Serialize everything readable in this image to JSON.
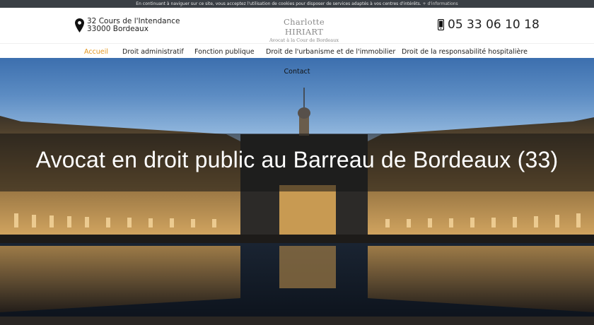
{
  "cookie_bar": {
    "text": "En continuant à naviguer sur ce site, vous acceptez l'utilisation de cookies pour disposer de services adaptés à vos centres d'intérêts.",
    "more_link": "+ d'informations"
  },
  "header": {
    "address_line1": "32 Cours de l'Intendance",
    "address_line2": "33000 Bordeaux",
    "logo_name": "Charlotte HIRIART",
    "logo_tagline": "Avocat à la Cour de Bordeaux",
    "phone": "05 33 06 10 18"
  },
  "nav": {
    "items": [
      {
        "label": "Accueil",
        "active": true
      },
      {
        "label": "Droit administratif"
      },
      {
        "label": "Fonction publique"
      },
      {
        "label": "Droit de l'urbanisme et de l'immobilier"
      },
      {
        "label": "Droit de la responsabilité hospitalière"
      },
      {
        "label": "Contact"
      }
    ]
  },
  "hero": {
    "title": "Avocat en droit public au Barreau de Bordeaux (33)"
  },
  "colors": {
    "accent": "#e3961f",
    "cookie_bar_bg": "#3a3f45",
    "title_band": "#141414"
  },
  "icons": {
    "address": "map-pin-icon",
    "phone": "mobile-phone-icon"
  }
}
